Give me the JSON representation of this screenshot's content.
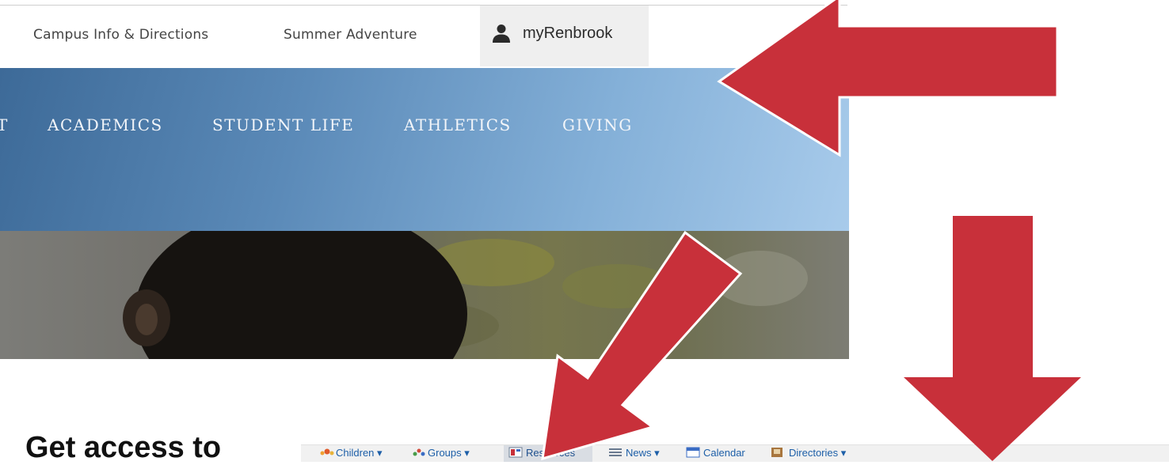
{
  "utility_nav": {
    "campus_info": "Campus Info & Directions",
    "summer_adventure": "Summer Adventure",
    "my_renbrook": "myRenbrook"
  },
  "main_nav": {
    "items": [
      "T",
      "ACADEMICS",
      "STUDENT LIFE",
      "ATHLETICS",
      "GIVING"
    ]
  },
  "caption": "Get access to",
  "portal_toolbar": {
    "children": "Children",
    "groups": "Groups",
    "resources": "Resources",
    "news": "News",
    "calendar": "Calendar",
    "directories": "Directories",
    "caret": "▾"
  },
  "colors": {
    "arrow": "#c8303a",
    "nav_band_start": "#3d6a98",
    "nav_band_end": "#a8cbeb",
    "link_blue": "#1d5fa8"
  }
}
